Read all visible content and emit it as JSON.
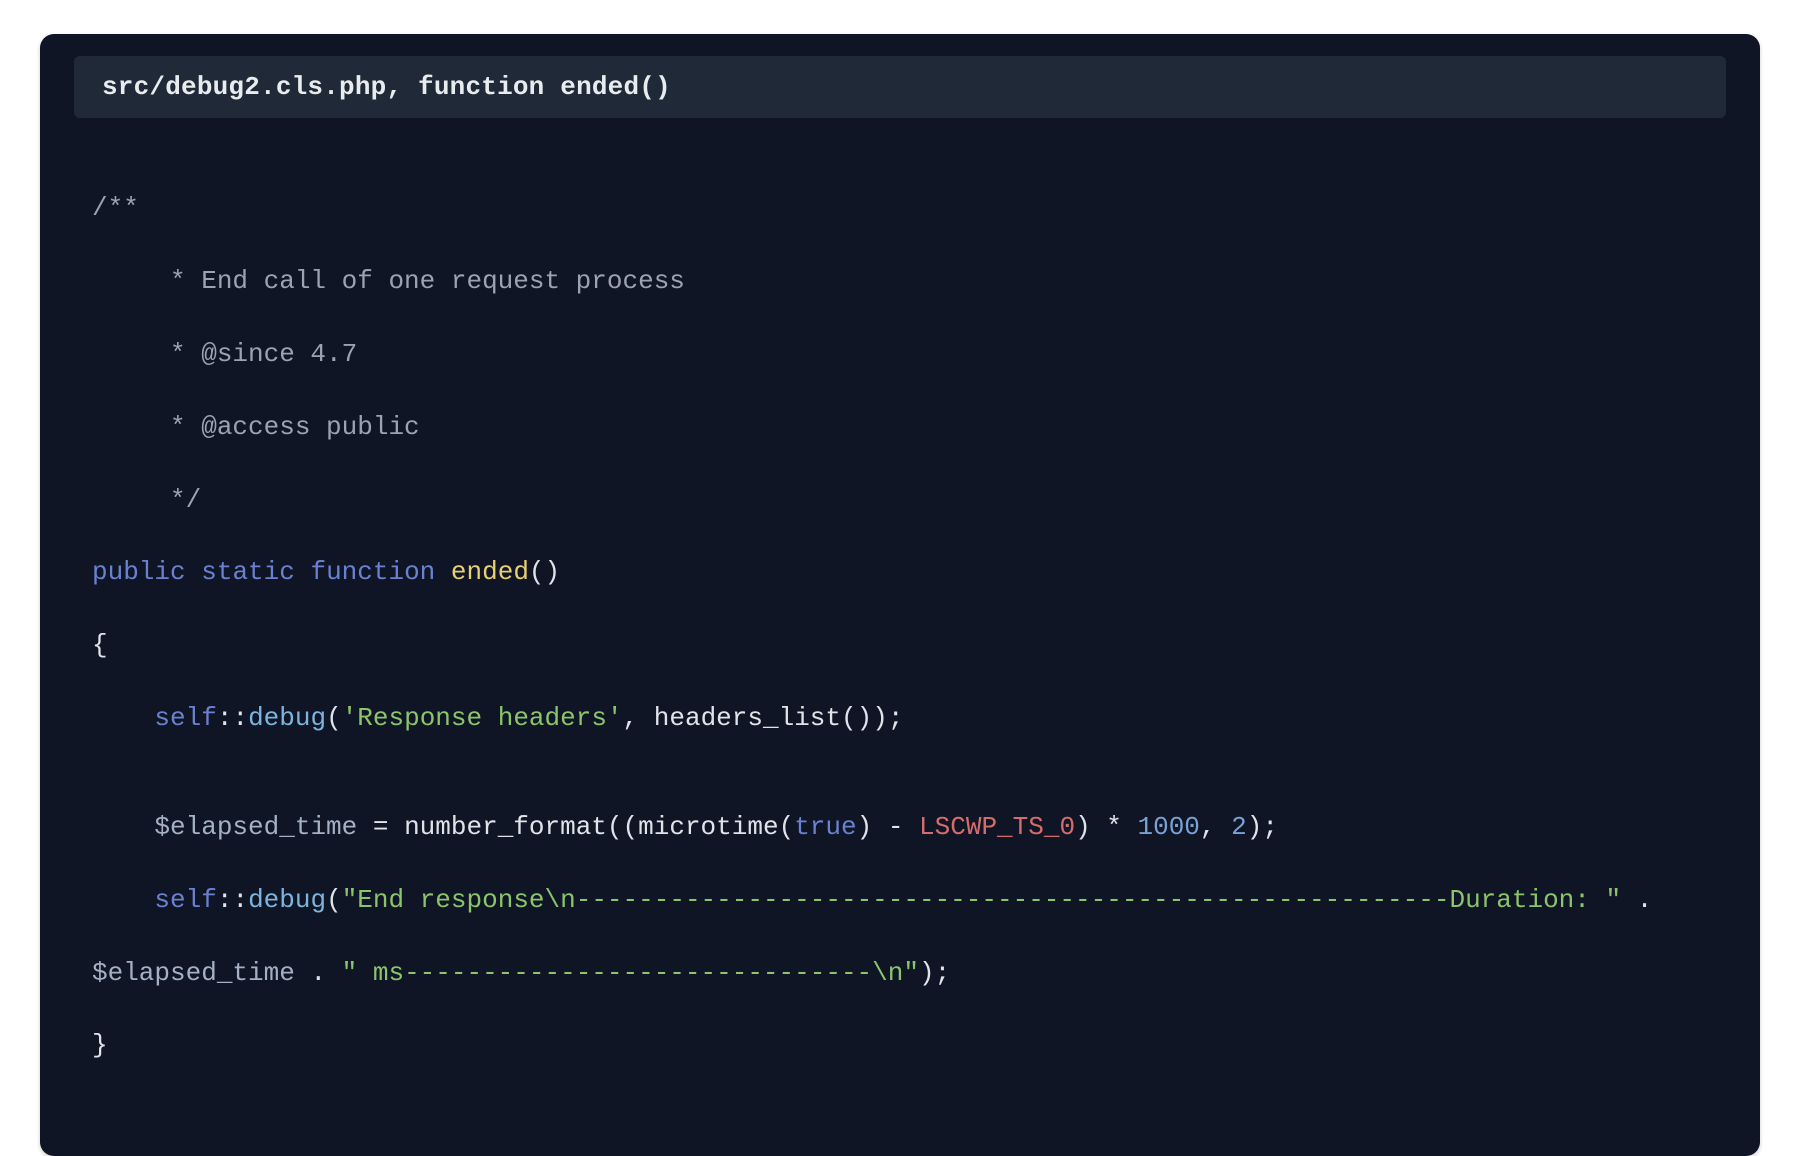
{
  "title": "src/debug2.cls.php, function ended()",
  "code": {
    "comment_open": "/**",
    "comment_l1": "     * End call of one request process",
    "comment_l2": "     * @since 4.7",
    "comment_l3": "     * @access public",
    "comment_close": "     */",
    "kw_public": "public",
    "kw_static": "static",
    "kw_function": "function",
    "fn_name": "ended",
    "paren_empty": "()",
    "brace_open": "{",
    "self1": "self",
    "dcolon": "::",
    "debug1": "debug",
    "str_resp_headers": "'Response headers'",
    "comma_sp": ", ",
    "headers_list": "headers_list",
    "paren_open": "(",
    "paren_close": ")",
    "paren_close2": ")",
    "semi": ";",
    "var_elapsed": "$elapsed_time",
    "eq": " = ",
    "number_format": "number_format",
    "microtime": "microtime",
    "true": "true",
    "minus": " - ",
    "const_lscwp": "LSCWP_TS_0",
    "times": " * ",
    "num_1000": "1000",
    "num_2": "2",
    "self2": "self",
    "debug2": "debug",
    "str_end_resp": "\"End response\\n--------------------------------------------------------Duration: \"",
    "concat": " . ",
    "str_ms": "\" ms------------------------------\\n\"",
    "brace_close": "}"
  }
}
